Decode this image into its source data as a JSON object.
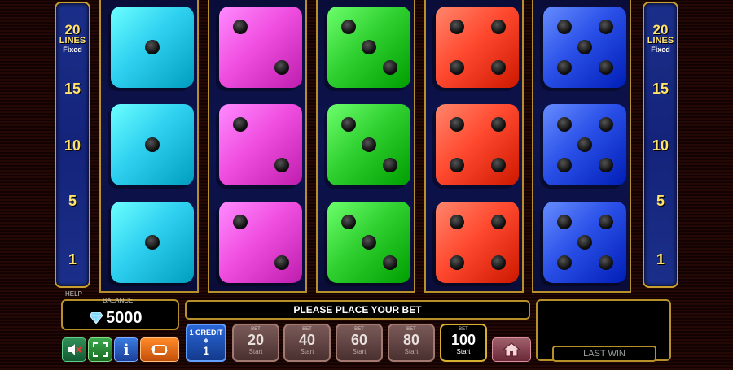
{
  "lines_panel": {
    "count": "20",
    "word": "LINES",
    "fixed": "Fixed",
    "markers": [
      "15",
      "10",
      "5",
      "1"
    ]
  },
  "reels": [
    {
      "color": "#2fd0f0",
      "faces": [
        1,
        1,
        1
      ]
    },
    {
      "color": "#f04fe0",
      "faces": [
        2,
        2,
        2
      ]
    },
    {
      "color": "#30d030",
      "faces": [
        3,
        3,
        3
      ]
    },
    {
      "color": "#ff4a30",
      "faces": [
        4,
        4,
        4
      ]
    },
    {
      "color": "#2a50e8",
      "faces": [
        5,
        5,
        5
      ]
    }
  ],
  "help_label": "HELP",
  "balance": {
    "label": "BALANCE",
    "value": "5000",
    "icon": "gem-icon"
  },
  "message": "PLEASE PLACE YOUR BET",
  "last_win": {
    "label": "LAST WIN"
  },
  "controls": {
    "sound_icon": "sound-mute-icon",
    "fullscreen_icon": "fullscreen-icon",
    "info_label": "i",
    "autoplay_icon": "autoplay-icon",
    "home_icon": "home-icon"
  },
  "credit": {
    "title": "1 CREDIT",
    "denom": "◆",
    "value": "1"
  },
  "bets": [
    {
      "top": "BET",
      "value": "20",
      "sub": "Start",
      "active": false
    },
    {
      "top": "BET",
      "value": "40",
      "sub": "Start",
      "active": false
    },
    {
      "top": "BET",
      "value": "60",
      "sub": "Start",
      "active": false
    },
    {
      "top": "BET",
      "value": "80",
      "sub": "Start",
      "active": false
    },
    {
      "top": "BET",
      "value": "100",
      "sub": "Start",
      "active": true
    }
  ],
  "colors": {
    "frame_gold": "#b8902a",
    "panel_blue": "#1b2f8a",
    "line_text": "#ffe36a"
  }
}
